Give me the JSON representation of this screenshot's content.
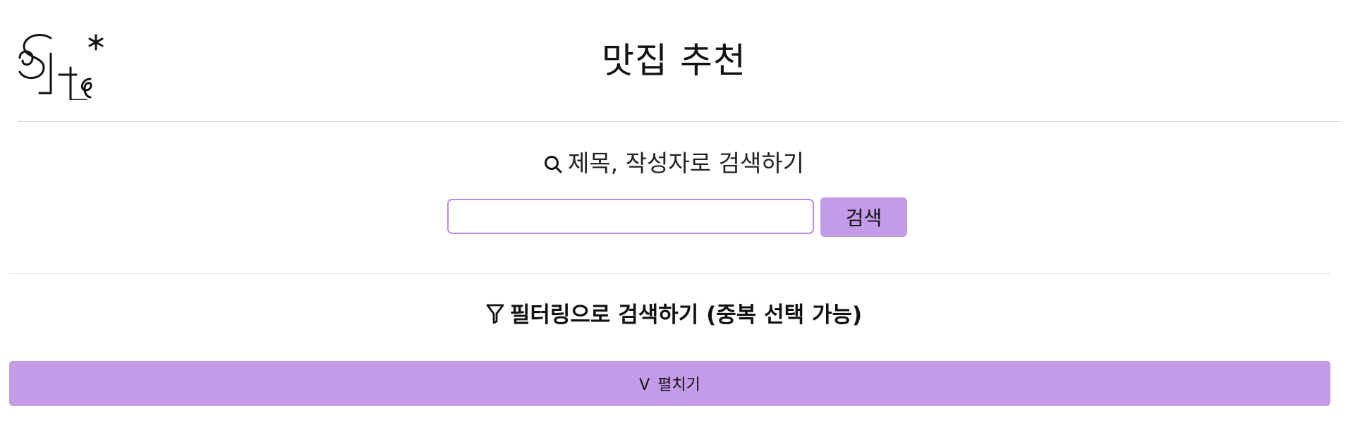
{
  "header": {
    "logo_name": "logo",
    "title": "맛집 추천"
  },
  "search": {
    "heading_icon": "search-icon",
    "heading": "제목, 작성자로 검색하기",
    "input_value": "",
    "input_placeholder": "",
    "button_label": "검색"
  },
  "filter": {
    "heading_icon": "filter-icon",
    "heading": "필터링으로 검색하기 (중복 선택 가능)",
    "expand_chevron": "V",
    "expand_label": "펼치기"
  },
  "colors": {
    "accent": "#c39be6",
    "input_border": "#b98ee6",
    "divider": "#d4d4d4"
  }
}
